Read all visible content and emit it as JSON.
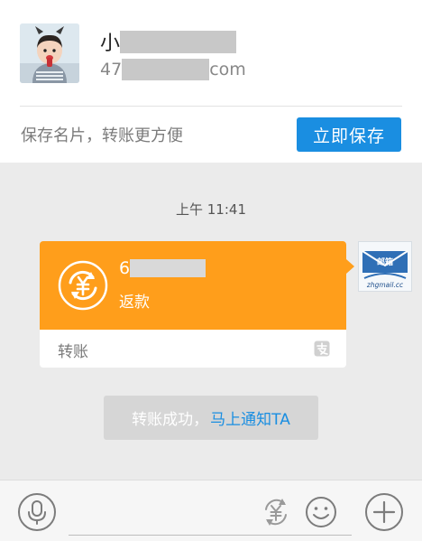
{
  "contact": {
    "name_visible": "小",
    "email_prefix": "47",
    "email_suffix": "com",
    "save_hint": "保存名片，转账更方便",
    "save_button": "立即保存"
  },
  "chat": {
    "timestamp": "上午 11:41",
    "transfer": {
      "amount_prefix": "6",
      "kind": "返款",
      "label": "转账"
    },
    "peer_avatar_text": "zhgmail.cc",
    "system_notice": {
      "text": "转账成功，",
      "link": "马上通知TA"
    }
  },
  "input_bar": {
    "placeholder": ""
  },
  "colors": {
    "accent_blue": "#1a8ee1",
    "transfer_orange": "#ff9e1b",
    "background": "#ebebeb"
  },
  "icons": [
    "avatar-photo",
    "refund-coin-icon",
    "alipay-icon",
    "voice-icon",
    "transfer-money-icon",
    "emoji-icon",
    "plus-icon"
  ]
}
